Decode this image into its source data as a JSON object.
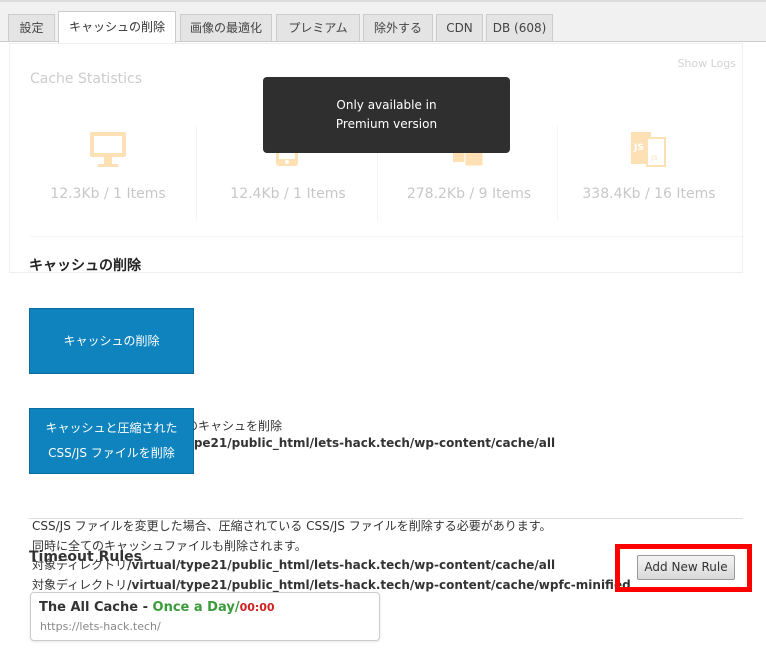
{
  "tabs": [
    {
      "label": "設定"
    },
    {
      "label": "キャッシュの削除"
    },
    {
      "label": "画像の最適化"
    },
    {
      "label": "プレミアム"
    },
    {
      "label": "除外する"
    },
    {
      "label": "CDN"
    },
    {
      "label": "DB (608)"
    }
  ],
  "stats": {
    "title": "Cache Statistics",
    "show_logs": "Show Logs",
    "items": [
      {
        "icon": "desktop-icon",
        "value": "12.3Kb / 1 Items"
      },
      {
        "icon": "mobile-icon",
        "value": "12.4Kb / 1 Items"
      },
      {
        "icon": "css-file-icon",
        "value": "278.2Kb / 9 Items"
      },
      {
        "icon": "js-file-icon",
        "value": "338.4Kb / 16 Items"
      }
    ],
    "accent": "#f7a11a"
  },
  "tooltip": {
    "line1": "Only available in",
    "line2": "Premium version"
  },
  "delete_section": {
    "title": "キャッシュの削除",
    "clear_button": "キャッシュの削除",
    "clear_min_line1": "キャッシュと圧縮された",
    "clear_min_line2": "CSS/JS ファイルを削除",
    "hidden_text1": "のキャシュを削除",
    "hidden_path1": "ype21/public_html/lets-hack.tech/wp-content/cache/all"
  },
  "description": {
    "line1": "CSS/JS ファイルを変更した場合、圧縮されている CSS/JS ファイルを削除する必要があります。",
    "line2": "同時に全てのキャッシュファイルも削除されます。",
    "line3_label": "対象ディレクトリ",
    "line3_path": "/virtual/type21/public_html/lets-hack.tech/wp-content/cache/all",
    "line4_label": "対象ディレクトリ",
    "line4_path": "/virtual/type21/public_html/lets-hack.tech/wp-content/cache/wpfc-minified"
  },
  "timeout": {
    "title": "Timeout Rules",
    "add_button": "Add New Rule",
    "rule": {
      "name": "The All Cache",
      "separator": " - ",
      "frequency": "Once a Day",
      "slash": "/",
      "time": "00:00",
      "url": "https://lets-hack.tech/"
    }
  },
  "colors": {
    "primary_button": "#0f83bd",
    "highlight": "#ff0000",
    "green": "#3a9b3a",
    "red": "#d02020"
  }
}
